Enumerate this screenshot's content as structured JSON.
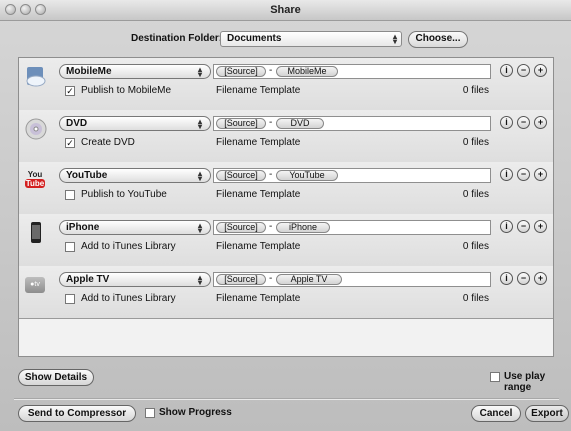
{
  "window": {
    "title": "Share"
  },
  "destination": {
    "label": "Destination Folder:",
    "value": "Documents",
    "choose_button": "Choose..."
  },
  "rows": [
    {
      "preset": "MobileMe",
      "checkbox_label": "Publish to MobileMe",
      "checked": true,
      "icon": "mobileme-icon",
      "tokens": [
        "[Source]",
        "MobileMe"
      ],
      "template_label": "Filename Template",
      "files": "0 files"
    },
    {
      "preset": "DVD",
      "checkbox_label": "Create DVD",
      "checked": true,
      "icon": "dvd-icon",
      "tokens": [
        "[Source]",
        "DVD"
      ],
      "template_label": "Filename Template",
      "files": "0 files"
    },
    {
      "preset": "YouTube",
      "checkbox_label": "Publish to YouTube",
      "checked": false,
      "icon": "youtube-icon",
      "tokens": [
        "[Source]",
        "YouTube"
      ],
      "template_label": "Filename Template",
      "files": "0 files"
    },
    {
      "preset": "iPhone",
      "checkbox_label": "Add to iTunes Library",
      "checked": false,
      "icon": "iphone-icon",
      "tokens": [
        "[Source]",
        "iPhone"
      ],
      "template_label": "Filename Template",
      "files": "0 files"
    },
    {
      "preset": "Apple TV",
      "checkbox_label": "Add to iTunes Library",
      "checked": false,
      "icon": "appletv-icon",
      "tokens": [
        "[Source]",
        "Apple TV"
      ],
      "template_label": "Filename Template",
      "files": "0 files"
    }
  ],
  "youtube_icon_text": {
    "line1": "You",
    "line2": "Tube"
  },
  "appletv_icon_text": "●tv",
  "controls": {
    "info": "i",
    "remove": "−",
    "add": "+"
  },
  "token_dash": "-",
  "footer": {
    "show_details": "Show Details",
    "use_play_range": "Use play range",
    "send_to_compressor": "Send to Compressor",
    "show_progress": "Show Progress",
    "cancel": "Cancel",
    "export": "Export"
  }
}
